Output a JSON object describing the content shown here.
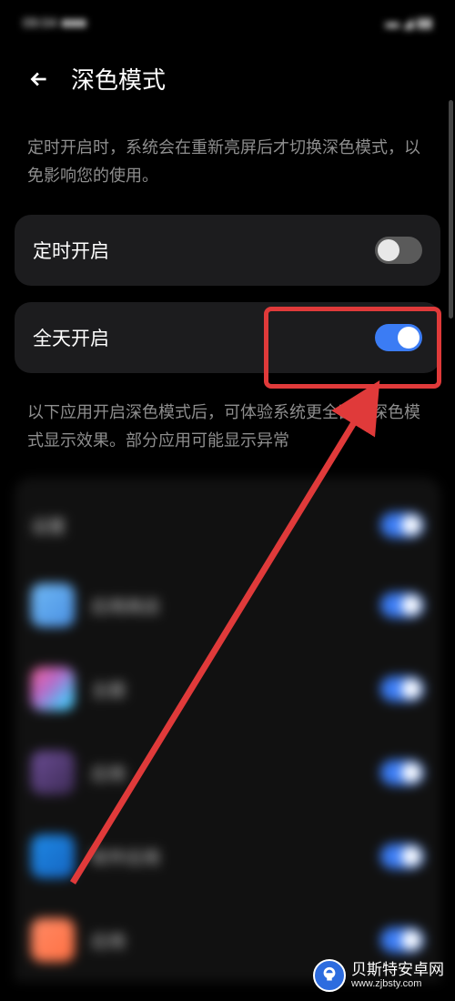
{
  "status": {
    "time": "09:04",
    "right": "  "
  },
  "header": {
    "title": "深色模式"
  },
  "description_top": "定时开启时，系统会在重新亮屏后才切换深色模式，以免影响您的使用。",
  "settings": {
    "scheduled": {
      "label": "定时开启",
      "on": false
    },
    "always": {
      "label": "全天开启",
      "on": true
    }
  },
  "description_apps": "以下应用开启深色模式后，可体验系统更全面的深色模式显示效果。部分应用可能显示异常",
  "apps": [
    {
      "name": "设置",
      "on": true
    },
    {
      "name": "应用商店",
      "on": true
    },
    {
      "name": "主题",
      "on": true
    },
    {
      "name": "应用",
      "on": true
    },
    {
      "name": "软件应用",
      "on": true
    },
    {
      "name": "应用",
      "on": true
    }
  ],
  "watermark": {
    "text": "贝斯特安卓网",
    "url": "www.zjbsty.com"
  },
  "colors": {
    "accent": "#3b7cf4",
    "highlight": "#e03a3a",
    "bg": "#000",
    "card": "#1c1c1e"
  }
}
